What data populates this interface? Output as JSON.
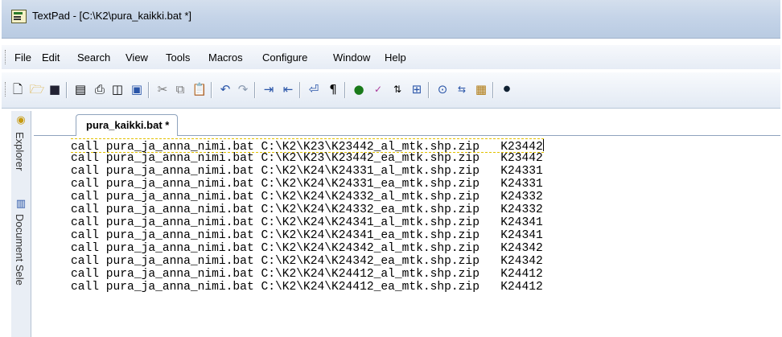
{
  "window": {
    "title": "TextPad - [C:\\K2\\pura_kaikki.bat *]"
  },
  "menu": [
    "File",
    "Edit",
    "Search",
    "View",
    "Tools",
    "Macros",
    "Configure",
    "Window",
    "Help"
  ],
  "toolbar": {
    "icons": [
      "new-file-icon",
      "open-file-icon",
      "save-icon",
      "save-all-icon",
      "print-icon",
      "print-preview-icon",
      "document-properties-icon",
      "cut-icon",
      "copy-icon",
      "paste-icon",
      "undo-icon",
      "redo-icon",
      "indent-icon",
      "outdent-icon",
      "word-wrap-icon",
      "show-formatting-icon",
      "web-browser-icon",
      "spell-check-icon",
      "sort-icon",
      "compare-icon",
      "find-icon",
      "replace-icon",
      "find-in-files-icon",
      "record-macro-icon"
    ]
  },
  "side_panel": {
    "explorer_label": "Explorer",
    "document_selector_label": "Document Sele"
  },
  "tab": {
    "label": "pura_kaikki.bat *"
  },
  "editor": {
    "lines": [
      "call pura_ja_anna_nimi.bat C:\\K2\\K23\\K23442_al_mtk.shp.zip   K23442",
      "call pura_ja_anna_nimi.bat C:\\K2\\K23\\K23442_ea_mtk.shp.zip   K23442",
      "call pura_ja_anna_nimi.bat C:\\K2\\K24\\K24331_al_mtk.shp.zip   K24331",
      "call pura_ja_anna_nimi.bat C:\\K2\\K24\\K24331_ea_mtk.shp.zip   K24331",
      "call pura_ja_anna_nimi.bat C:\\K2\\K24\\K24332_al_mtk.shp.zip   K24332",
      "call pura_ja_anna_nimi.bat C:\\K2\\K24\\K24332_ea_mtk.shp.zip   K24332",
      "call pura_ja_anna_nimi.bat C:\\K2\\K24\\K24341_al_mtk.shp.zip   K24341",
      "call pura_ja_anna_nimi.bat C:\\K2\\K24\\K24341_ea_mtk.shp.zip   K24341",
      "call pura_ja_anna_nimi.bat C:\\K2\\K24\\K24342_al_mtk.shp.zip   K24342",
      "call pura_ja_anna_nimi.bat C:\\K2\\K24\\K24342_ea_mtk.shp.zip   K24342",
      "call pura_ja_anna_nimi.bat C:\\K2\\K24\\K24412_al_mtk.shp.zip   K24412",
      "call pura_ja_anna_nimi.bat C:\\K2\\K24\\K24412_ea_mtk.shp.zip   K24412"
    ]
  },
  "colors": {
    "title_bar": "#c5d4e8",
    "current_line_border": "#e2c100"
  }
}
